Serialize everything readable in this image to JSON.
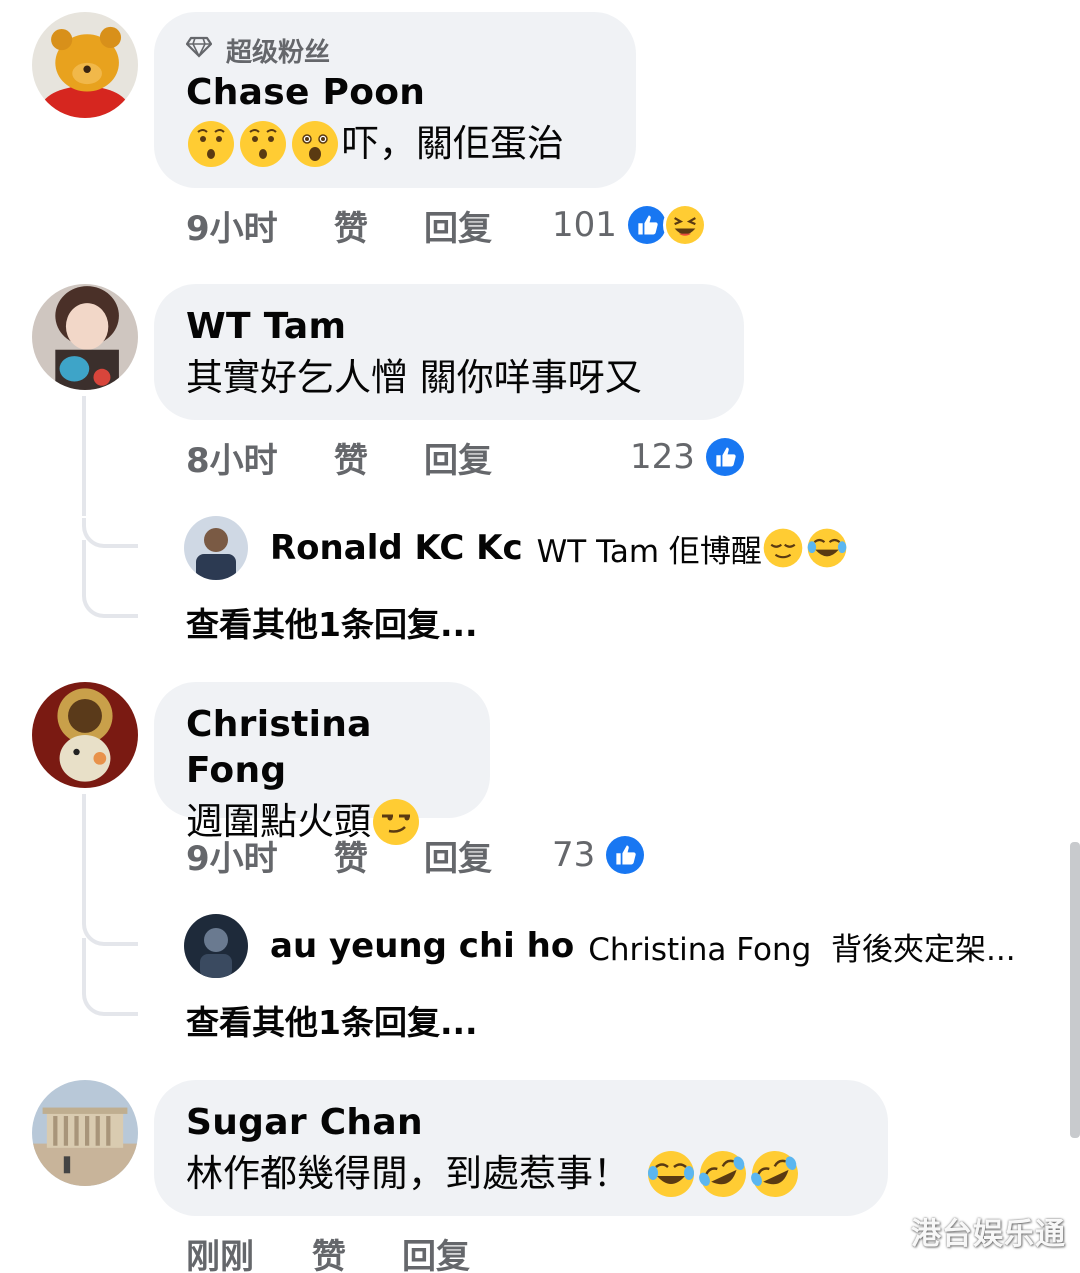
{
  "comments": [
    {
      "badge": "超级粉丝",
      "author": "Chase Poon",
      "text": "吓，關佢蛋治",
      "emojis_before": [
        "hushed-face",
        "hushed-face",
        "astonished-face"
      ],
      "time": "9小时",
      "like_label": "赞",
      "reply_label": "回复",
      "reaction_count": "101",
      "reactions": [
        "like",
        "laugh"
      ]
    },
    {
      "author": "WT Tam",
      "text": "其實好乞人憎 關你咩事呀又",
      "time": "8小时",
      "like_label": "赞",
      "reply_label": "回复",
      "reaction_count": "123",
      "reactions": [
        "like"
      ],
      "reply_preview": {
        "author": "Ronald KC Kc",
        "text": "WT Tam 佢博醒",
        "emojis_after": [
          "relieved-face",
          "tears-of-joy"
        ]
      },
      "more_replies": "查看其他1条回复..."
    },
    {
      "author": "Christina Fong",
      "text": "週圍點火頭",
      "emojis_after": [
        "smirking-face"
      ],
      "time": "9小时",
      "like_label": "赞",
      "reply_label": "回复",
      "reaction_count": "73",
      "reactions": [
        "like"
      ],
      "reply_preview": {
        "author": "au yeung chi ho",
        "text": "Christina Fong  背後夾定架..."
      },
      "more_replies": "查看其他1条回复..."
    },
    {
      "author": "Sugar Chan",
      "text": "林作都幾得閒，到處惹事！",
      "emojis_after": [
        "tears-of-joy",
        "rolling-laughing",
        "rolling-laughing"
      ],
      "time": "刚刚",
      "like_label": "赞",
      "reply_label": "回复"
    }
  ],
  "watermark": "港台娱乐通",
  "colors": {
    "bubble": "#f0f2f5",
    "meta_text": "#65676b",
    "like_blue": "#1877f2",
    "emoji_yellow": "#ffcc33"
  }
}
